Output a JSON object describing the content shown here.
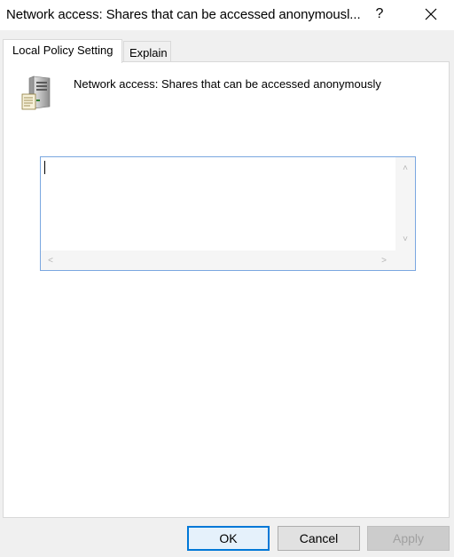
{
  "window": {
    "title": "Network access: Shares that can be accessed anonymousl...",
    "help_glyph": "?",
    "close_glyph": "×"
  },
  "tabs": [
    {
      "label": "Local Policy Setting",
      "active": true
    },
    {
      "label": "Explain",
      "active": false
    }
  ],
  "policy": {
    "icon": "server-icon",
    "name": "Network access: Shares that can be accessed anonymously"
  },
  "editor": {
    "value": "",
    "scroll_up_glyph": "˄",
    "scroll_down_glyph": "˅",
    "scroll_left_glyph": "<",
    "scroll_right_glyph": ">"
  },
  "buttons": {
    "ok": "OK",
    "cancel": "Cancel",
    "apply": "Apply"
  },
  "colors": {
    "focus_border": "#0078d7",
    "edit_border": "#7aa7e0"
  }
}
